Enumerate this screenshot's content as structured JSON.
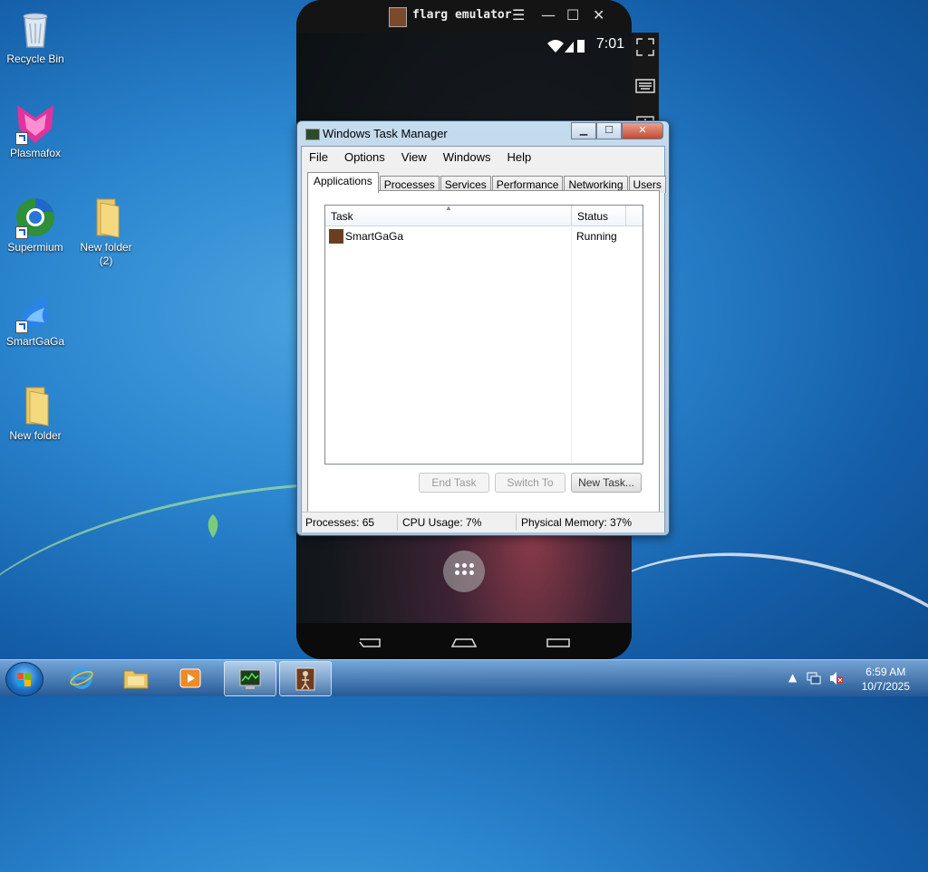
{
  "desktop": {
    "icons": [
      {
        "label": "Recycle Bin"
      },
      {
        "label": "Plasmafox"
      },
      {
        "label": "Supermium"
      },
      {
        "label": "New folder (2)"
      },
      {
        "label": "SmartGaGa"
      },
      {
        "label": "New folder"
      }
    ]
  },
  "emulator": {
    "title": "flarg emulator",
    "status_time": "7:01"
  },
  "task_manager": {
    "title": "Windows Task Manager",
    "menu": [
      "File",
      "Options",
      "View",
      "Windows",
      "Help"
    ],
    "tabs": [
      "Applications",
      "Processes",
      "Services",
      "Performance",
      "Networking",
      "Users"
    ],
    "active_tab": "Applications",
    "columns": [
      "Task",
      "Status"
    ],
    "rows": [
      {
        "task": "SmartGaGa",
        "status": "Running"
      }
    ],
    "buttons": {
      "end_task": "End Task",
      "switch_to": "Switch To",
      "new_task": "New Task..."
    },
    "statusbar": {
      "processes": "Processes: 65",
      "cpu": "CPU Usage: 7%",
      "memory": "Physical Memory: 37%"
    }
  },
  "taskbar": {
    "time": "6:59 AM",
    "date": "10/7/2025"
  }
}
